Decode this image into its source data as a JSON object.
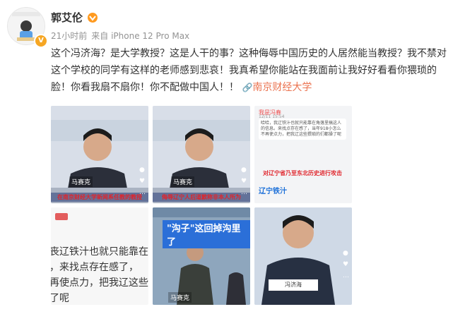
{
  "user": {
    "name": "郭艾伦",
    "verified_icon": "verified-v-icon",
    "member_icon": "member-badge-icon",
    "brand_color": "#eb7350",
    "verified_color": "#f6a623"
  },
  "meta": {
    "time": "21小时前",
    "source": "来自 iPhone 12 Pro Max"
  },
  "post": {
    "text_main": "这个冯济海？是大学教授？这是人干的事？这种侮辱中国历史的人居然能当教授？我不禁对这个学校的同学有这样的老师感到悲哀！我真希望你能站在我面前让我好好看看你猥琐的",
    "text_tail": "脸！你看我扇不扇你！你不配做中国人！！",
    "topic_link": "南京财经大学",
    "link_icon": "link-icon"
  },
  "images": {
    "img1": {
      "name_tag": "马赛克",
      "caption": "在南京财经大学新闻系任教的教授"
    },
    "img2": {
      "name_tag": "马赛克",
      "caption": "侮辱辽宁人后道歉称非本人所为"
    },
    "img3": {
      "header": "我是冯春",
      "time": "12/11 15:54",
      "chat": "哈哈，我辽铁汁也就只能靠在角落里搞这人的信息。来找点存在感了，当年918小怎么不再使点力，把我辽这些猥琐的们都操了呢",
      "caption": "对辽宁省乃至东北历史进行攻击",
      "blue_text": "辽宁铁汁"
    },
    "img4": {
      "zoom_text": "丧辽铁汁也就只能靠在\n，来找点存在感了，\n再使点力，把我辽这些\n了呢"
    },
    "img5": {
      "title": "\"沟子\"这回掉沟里了",
      "name_tag": "马赛克"
    },
    "img6": {
      "board": "冯济海"
    }
  }
}
